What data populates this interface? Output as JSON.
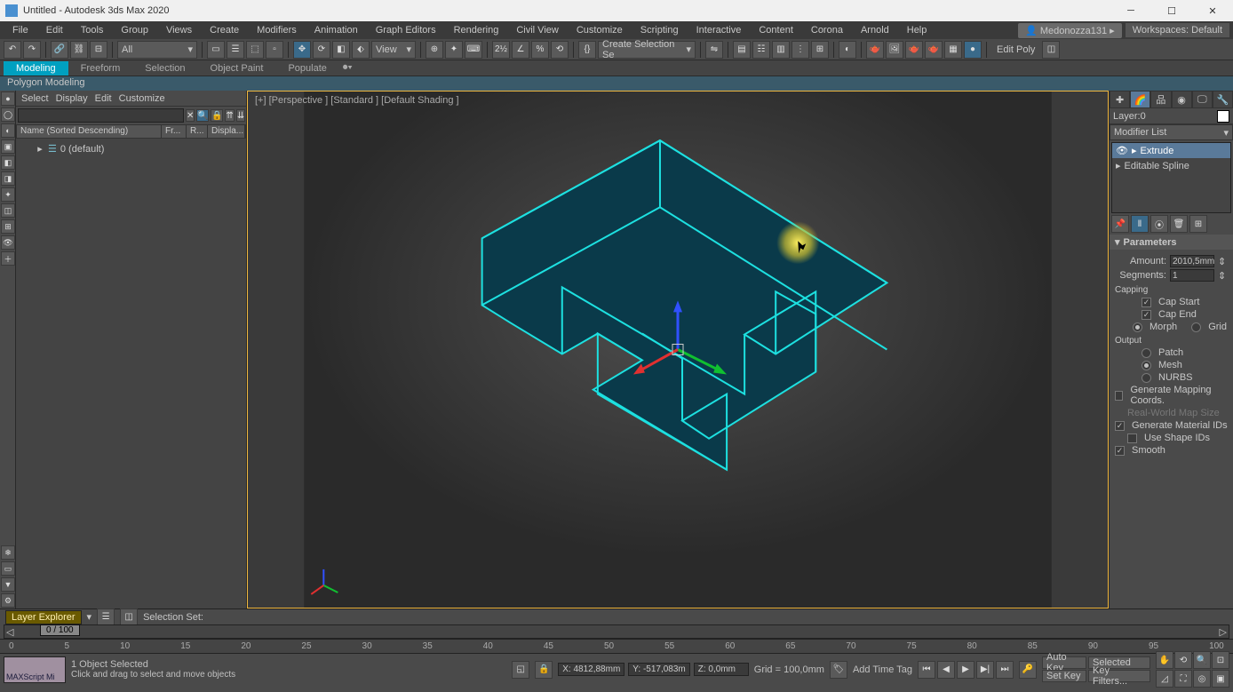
{
  "title": "Untitled - Autodesk 3ds Max 2020",
  "user": "Medonozza131",
  "workspaces": {
    "label": "Workspaces:",
    "value": "Default"
  },
  "menu": [
    "File",
    "Edit",
    "Tools",
    "Group",
    "Views",
    "Create",
    "Modifiers",
    "Animation",
    "Graph Editors",
    "Rendering",
    "Civil View",
    "Customize",
    "Scripting",
    "Interactive",
    "Content",
    "Corona",
    "Arnold",
    "Help"
  ],
  "objfilter": "All",
  "viewlabel": "View",
  "createSel": "Create Selection Se",
  "editPoly": "Edit Poly",
  "ribbon_tabs": [
    "Modeling",
    "Freeform",
    "Selection",
    "Object Paint",
    "Populate"
  ],
  "polymod": "Polygon Modeling",
  "explorer": {
    "menu": [
      "Select",
      "Display",
      "Edit",
      "Customize"
    ],
    "cols": [
      "Name (Sorted Descending)",
      "Fr...",
      "R...",
      "Displa..."
    ],
    "node": "0 (default)"
  },
  "viewport_label": "[+] [Perspective ] [Standard ] [Default Shading ]",
  "cmdpanel": {
    "layer": "Layer:0",
    "modlist": "Modifier List",
    "stack": [
      {
        "name": "Extrude",
        "sel": true
      },
      {
        "name": "Editable Spline",
        "sel": false
      }
    ],
    "params_title": "Parameters",
    "amount": {
      "label": "Amount:",
      "value": "2010,5mm"
    },
    "segments": {
      "label": "Segments:",
      "value": "1"
    },
    "capping": "Capping",
    "cap_start": "Cap Start",
    "cap_end": "Cap End",
    "morph": "Morph",
    "grid": "Grid",
    "output": "Output",
    "patch": "Patch",
    "mesh": "Mesh",
    "nurbs": "NURBS",
    "gmc": "Generate Mapping Coords.",
    "rws": "Real-World Map Size",
    "gmi": "Generate Material IDs",
    "usi": "Use Shape IDs",
    "smooth": "Smooth"
  },
  "layer_explorer": "Layer Explorer",
  "selset": "Selection Set:",
  "time_thumb": "0 / 100",
  "ruler": [
    "0",
    "5",
    "10",
    "15",
    "20",
    "25",
    "30",
    "35",
    "40",
    "45",
    "50",
    "55",
    "60",
    "65",
    "70",
    "75",
    "80",
    "85",
    "90",
    "95",
    "100"
  ],
  "status": {
    "maxscript": "MAXScript Mi",
    "selected": "1 Object Selected",
    "hint": "Click and drag to select and move objects",
    "x": "X: 4812,88mm",
    "y": "Y: -517,083m",
    "z": "Z: 0,0mm",
    "grid": "Grid = 100,0mm",
    "addtime": "Add Time Tag",
    "autokey": "Auto Key",
    "selectedbtn": "Selected",
    "setkey": "Set Key",
    "keyfilters": "Key Filters..."
  }
}
